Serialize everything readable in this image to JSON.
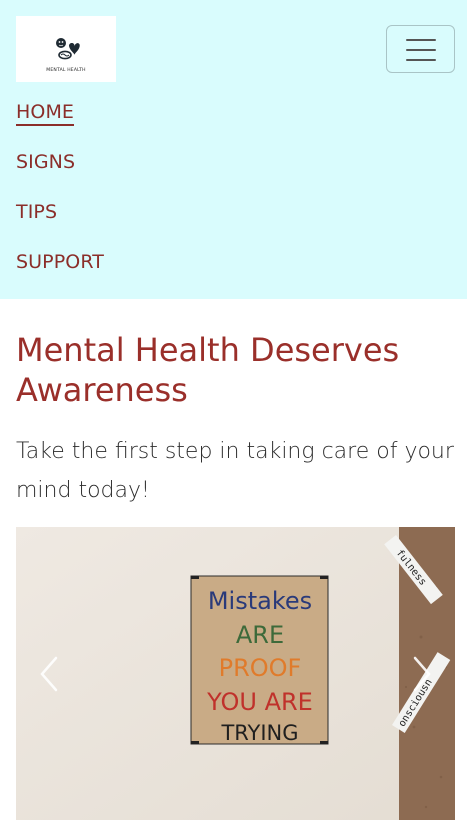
{
  "brand": {
    "logo_text": "MENTAL HEALTH",
    "logo_icon": "head-heart-icon"
  },
  "nav": {
    "toggle_icon": "hamburger-menu-icon",
    "items": [
      {
        "label": "HOME",
        "active": true
      },
      {
        "label": "SIGNS"
      },
      {
        "label": "TIPS"
      },
      {
        "label": "SUPPORT"
      }
    ]
  },
  "hero": {
    "title": "Mental Health Deserves Awareness",
    "subtitle": "Take the first step in taking care of your mind today!"
  },
  "carousel": {
    "slide": {
      "sign_lines": [
        "Mistakes",
        "ARE",
        "PROOF",
        "YOU ARE",
        "TRYING"
      ],
      "strip_words": [
        "fulness",
        "onsciousn"
      ]
    },
    "prev_icon": "chevron-left-icon",
    "next_icon": "chevron-right-icon"
  },
  "colors": {
    "nav_background": "#d9fcfd",
    "accent": "#9a2f2a",
    "text": "#2c2c2c"
  }
}
